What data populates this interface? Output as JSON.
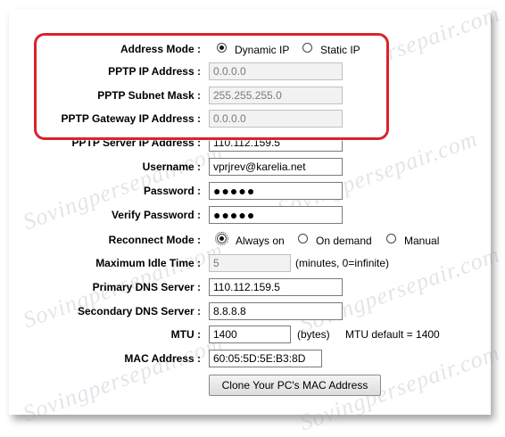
{
  "watermark": "Sovingpersepair.com",
  "form": {
    "address_mode": {
      "label": "Address Mode :",
      "options": [
        "Dynamic IP",
        "Static IP"
      ],
      "selected": "Dynamic IP"
    },
    "pptp_ip": {
      "label": "PPTP IP Address :",
      "value": "0.0.0.0"
    },
    "pptp_subnet": {
      "label": "PPTP Subnet Mask :",
      "value": "255.255.255.0"
    },
    "pptp_gateway": {
      "label": "PPTP Gateway IP Address :",
      "value": "0.0.0.0"
    },
    "pptp_server": {
      "label": "PPTP Server IP Address :",
      "value": "110.112.159.5"
    },
    "username": {
      "label": "Username :",
      "value": "vprjrev@karelia.net"
    },
    "password": {
      "label": "Password :",
      "value": "●●●●●"
    },
    "verify_password": {
      "label": "Verify Password :",
      "value": "●●●●●"
    },
    "reconnect_mode": {
      "label": "Reconnect Mode :",
      "options": [
        "Always on",
        "On demand",
        "Manual"
      ],
      "selected": "Always on"
    },
    "max_idle": {
      "label": "Maximum Idle Time :",
      "value": "5",
      "hint": "(minutes, 0=infinite)"
    },
    "primary_dns": {
      "label": "Primary DNS Server :",
      "value": "110.112.159.5"
    },
    "secondary_dns": {
      "label": "Secondary DNS Server :",
      "value": "8.8.8.8"
    },
    "mtu": {
      "label": "MTU :",
      "value": "1400",
      "unit": "(bytes)",
      "default_text": "MTU default = 1400"
    },
    "mac": {
      "label": "MAC Address :",
      "value": "60:05:5D:5E:B3:8D"
    },
    "clone_button": "Clone Your PC's MAC Address"
  },
  "colors": {
    "highlight": "#d9232d",
    "field_border": "#7a7a7a",
    "disabled_bg": "#f2f2f2"
  }
}
